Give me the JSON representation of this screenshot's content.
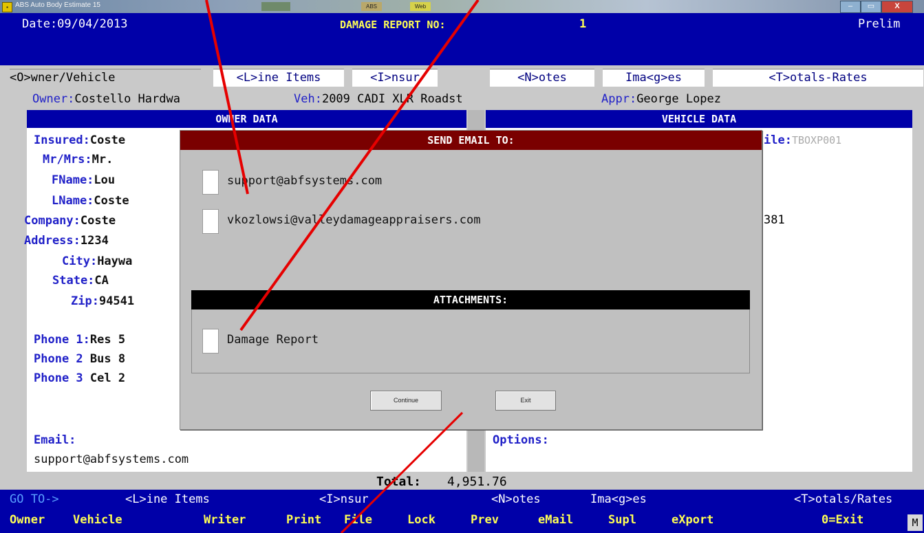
{
  "window": {
    "title": "ABS Auto Body Estimate 15",
    "thumbs": [
      "ABS",
      "Web"
    ],
    "controls": {
      "minimize": "–",
      "maximize": "▭",
      "close": "X"
    }
  },
  "header": {
    "date": "Date:09/04/2013",
    "report_label": "DAMAGE REPORT NO:",
    "report_no": "1",
    "status": "Prelim"
  },
  "tabs": [
    "<O>wner/Vehicle",
    "<L>ine Items",
    "<I>nsur",
    "<N>otes",
    "Ima<g>es",
    "<T>otals-Rates"
  ],
  "summary": {
    "owner_label": "Owner:",
    "owner_value": "Costello Hardwa",
    "veh_label": "Veh:",
    "veh_value": "2009 CADI XLR Roadst",
    "appr_label": "Appr:",
    "appr_value": "George Lopez"
  },
  "sections": {
    "owner": "OWNER DATA",
    "vehicle": "VEHICLE DATA"
  },
  "owner": {
    "insured_label": "Insured:",
    "insured_value": "Coste",
    "mrmrs_label": "Mr/Mrs:",
    "mrmrs_value": "Mr.",
    "fname_label": "FName:",
    "fname_value": "Lou",
    "lname_label": "LName:",
    "lname_value": "Coste",
    "company_label": "Company:",
    "company_value": "Coste",
    "address_label": "Address:",
    "address_value": "1234",
    "city_label": "City:",
    "city_value": "Haywa",
    "state_label": "State:",
    "state_value": "CA",
    "zip_label": "Zip:",
    "zip_value": "94541",
    "phone1_label": "Phone 1:",
    "phone1_value": "Res 5",
    "phone2_label": "Phone 2",
    "phone2_value": "Bus 8",
    "phone3_label": "Phone 3",
    "phone3_value": "Cel 2",
    "email_label": "Email:",
    "email_value": "support@abfsystems.com"
  },
  "vehicle": {
    "file_label": "ile:",
    "file_value": "TBOXP001",
    "vin_tail": "381",
    "options_label": "Options:"
  },
  "total": {
    "label": "Total:",
    "value": "4,951.76"
  },
  "footer": {
    "row1": {
      "goto": "GO TO->",
      "items": [
        "<L>ine Items",
        "<I>nsur",
        "<N>otes",
        "Ima<g>es",
        "<T>otals/Rates"
      ]
    },
    "row2": [
      "Owner",
      "Vehicle",
      "Writer",
      "Print",
      "File",
      "Lock",
      "Prev",
      "eMail",
      "Supl",
      "eXport",
      "0=Exit"
    ],
    "m_box": "M"
  },
  "dialog": {
    "title": "SEND EMAIL TO:",
    "recipients": [
      "support@abfsystems.com",
      "vkozlowsi@valleydamageappraisers.com"
    ],
    "attachments_title": "ATTACHMENTS:",
    "attachments": [
      "Damage Report"
    ],
    "continue_label": "Continue",
    "exit_label": "Exit"
  },
  "colors": {
    "header_blue": "#0000a8",
    "dialog_title": "#7a0000",
    "annotation_red": "#e60000",
    "label_blue": "#2020c8",
    "highlight_yellow": "#ffff54"
  }
}
